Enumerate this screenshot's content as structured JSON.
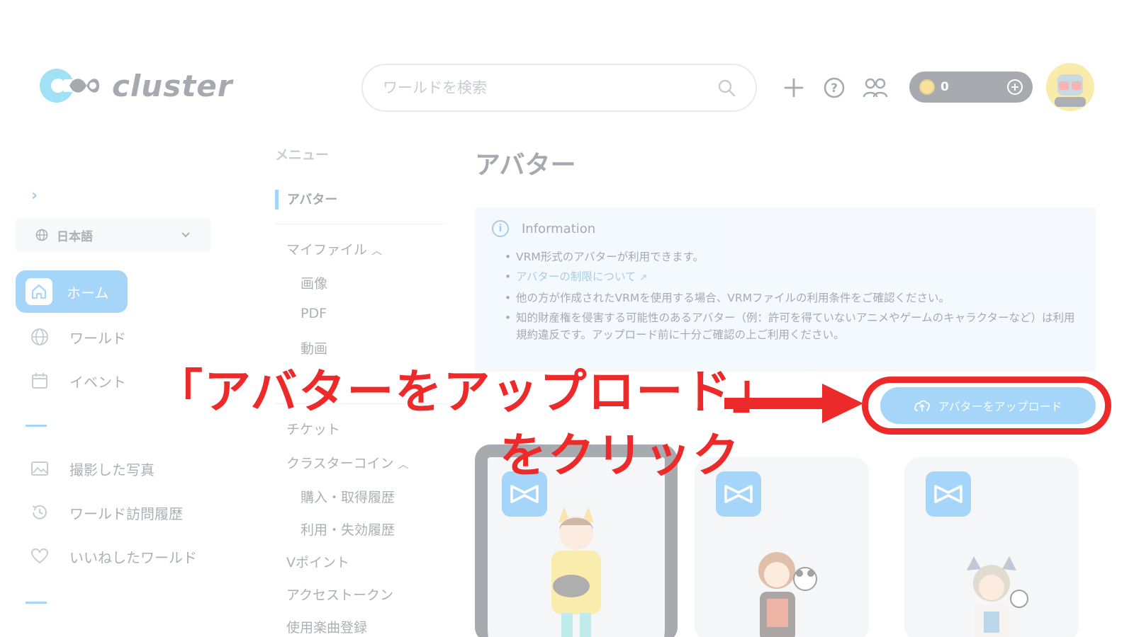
{
  "header": {
    "logo_text": "cluster",
    "search_placeholder": "ワールドを検索",
    "coin_count": "0"
  },
  "sidebar": {
    "language": "日本語",
    "items": [
      {
        "label": "ホーム",
        "icon": "home-icon",
        "active": true
      },
      {
        "label": "ワールド",
        "icon": "globe-icon"
      },
      {
        "label": "イベント",
        "icon": "calendar-icon"
      },
      {
        "label": "撮影した写真",
        "icon": "photo-icon"
      },
      {
        "label": "ワールド訪問履歴",
        "icon": "history-icon"
      },
      {
        "label": "いいねしたワールド",
        "icon": "heart-icon"
      }
    ]
  },
  "menu": {
    "heading": "メニュー",
    "active": "アバター",
    "my_files": "マイファイル",
    "my_files_children": [
      "画像",
      "PDF",
      "動画"
    ],
    "ticket": "チケット",
    "cluster_coin": "クラスターコイン",
    "cluster_coin_children": [
      "購入・取得履歴",
      "利用・失効履歴"
    ],
    "vpoint": "Vポイント",
    "access_token": "アクセストークン",
    "music": "使用楽曲登録"
  },
  "main": {
    "title": "アバター",
    "info_title": "Information",
    "info_items": [
      "VRM形式のアバターが利用できます。",
      "アバターの制限について",
      "他の方が作成されたVRMを使用する場合、VRMファイルの利用条件をご確認ください。",
      "知的財産権を侵害する可能性のあるアバター（例：許可を得ていないアニメやゲームのキャラクターなど）は利用規約違反です。アップロード前に十分ご確認の上ご利用ください。"
    ],
    "upload_label": "アバターをアップロード"
  },
  "annotation": {
    "line1": "「アバターをアップロード」",
    "line2": "をクリック"
  },
  "colors": {
    "accent": "#2a9cf0",
    "annotation_red": "#ec2a2a",
    "dark": "#2f3946"
  }
}
